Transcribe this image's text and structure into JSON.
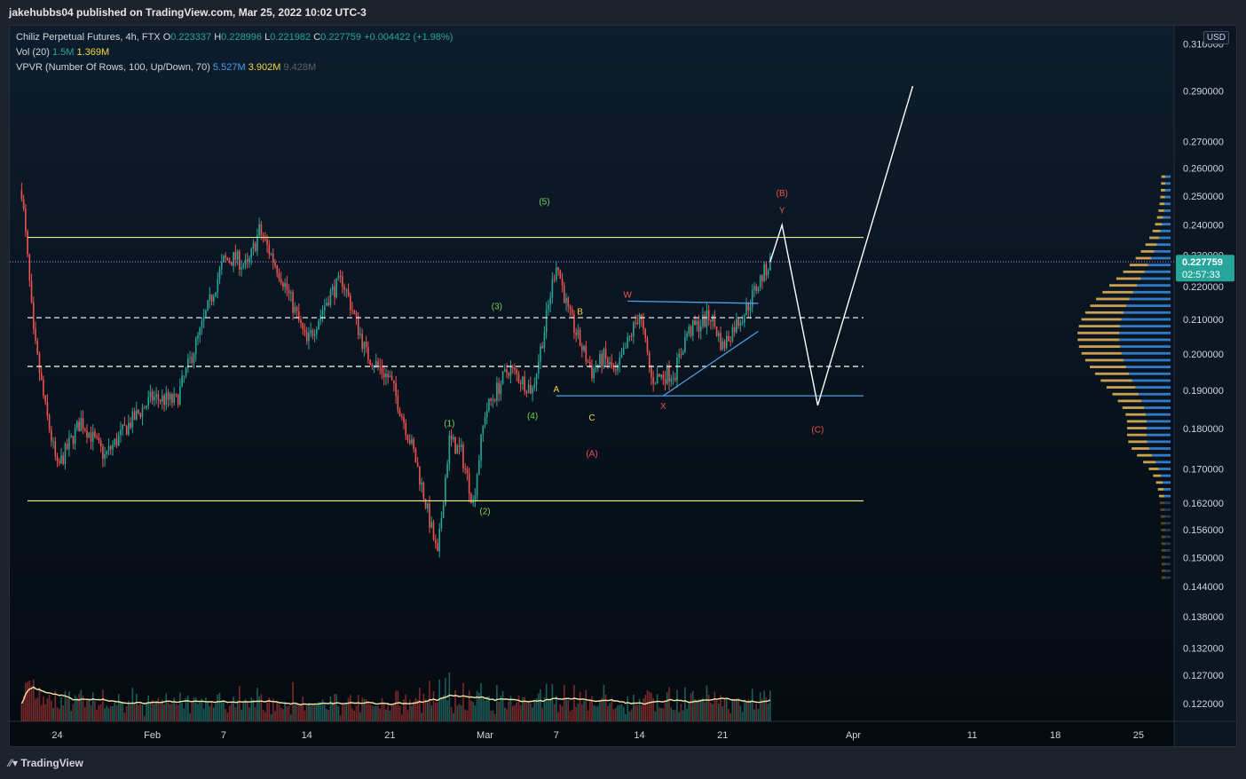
{
  "header": {
    "published_line": "jakehubbs04 published on TradingView.com, Mar 25, 2022 10:02 UTC-3"
  },
  "legend": {
    "symbol": "Chiliz Perpetual Futures, 4h, FTX",
    "o_label": "O",
    "o": "0.223337",
    "h_label": "H",
    "h": "0.228996",
    "l_label": "L",
    "l": "0.221982",
    "c_label": "C",
    "c": "0.227759",
    "change": "+0.004422 (+1.98%)",
    "vol_label": "Vol (20)",
    "vol1": "1.5M",
    "vol2": "1.369M",
    "vpvr_label": "VPVR (Number Of Rows, 100, Up/Down, 70)",
    "vpvr_up": "5.527M",
    "vpvr_down": "3.902M",
    "vpvr_total": "9.428M"
  },
  "currency": "USD",
  "price_axis": {
    "ticks": [
      "0.310000",
      "0.290000",
      "0.270000",
      "0.260000",
      "0.250000",
      "0.240000",
      "0.230000",
      "0.220000",
      "0.210000",
      "0.200000",
      "0.190000",
      "0.180000",
      "0.170000",
      "0.162000",
      "0.156000",
      "0.150000",
      "0.144000",
      "0.138000",
      "0.132000",
      "0.127000",
      "0.122000"
    ],
    "last_price": "0.227759",
    "countdown": "02:57:33"
  },
  "time_axis": {
    "labels": [
      "24",
      "Feb",
      "7",
      "14",
      "21",
      "Mar",
      "7",
      "14",
      "21",
      "Apr",
      "11",
      "18",
      "25"
    ]
  },
  "footer": {
    "brand": "TradingView"
  },
  "colors": {
    "up": "#26a69a",
    "down": "#ef5350",
    "accent_line": "#e6e68a",
    "current_price": "#c678dd",
    "badge": "#26a69a"
  },
  "chart_data": {
    "type": "candlestick",
    "symbol": "Chiliz Perpetual Futures",
    "interval": "4h",
    "exchange": "FTX",
    "x_range": [
      "2022-01-20",
      "2022-04-28"
    ],
    "ylim": [
      0.119,
      0.318
    ],
    "y_scale": "log",
    "close_series": [
      [
        "2022-01-21",
        0.252
      ],
      [
        "2022-01-22",
        0.205
      ],
      [
        "2022-01-23",
        0.185
      ],
      [
        "2022-01-24",
        0.17
      ],
      [
        "2022-01-25",
        0.176
      ],
      [
        "2022-01-26",
        0.182
      ],
      [
        "2022-01-28",
        0.173
      ],
      [
        "2022-01-30",
        0.181
      ],
      [
        "2022-02-01",
        0.188
      ],
      [
        "2022-02-03",
        0.187
      ],
      [
        "2022-02-05",
        0.206
      ],
      [
        "2022-02-07",
        0.228
      ],
      [
        "2022-02-08",
        0.229
      ],
      [
        "2022-02-09",
        0.226
      ],
      [
        "2022-02-10",
        0.238
      ],
      [
        "2022-02-12",
        0.222
      ],
      [
        "2022-02-14",
        0.203
      ],
      [
        "2022-02-16",
        0.218
      ],
      [
        "2022-02-17",
        0.222
      ],
      [
        "2022-02-19",
        0.2
      ],
      [
        "2022-02-21",
        0.193
      ],
      [
        "2022-02-23",
        0.174
      ],
      [
        "2022-02-24",
        0.162
      ],
      [
        "2022-02-25",
        0.15
      ],
      [
        "2022-02-26",
        0.177
      ],
      [
        "2022-02-27",
        0.174
      ],
      [
        "2022-02-28",
        0.162
      ],
      [
        "2022-03-01",
        0.184
      ],
      [
        "2022-03-03",
        0.196
      ],
      [
        "2022-03-05",
        0.19
      ],
      [
        "2022-03-06",
        0.207
      ],
      [
        "2022-03-07",
        0.228
      ],
      [
        "2022-03-08",
        0.212
      ],
      [
        "2022-03-09",
        0.203
      ],
      [
        "2022-03-10",
        0.195
      ],
      [
        "2022-03-11",
        0.199
      ],
      [
        "2022-03-12",
        0.194
      ],
      [
        "2022-03-14",
        0.212
      ],
      [
        "2022-03-15",
        0.193
      ],
      [
        "2022-03-17",
        0.195
      ],
      [
        "2022-03-18",
        0.206
      ],
      [
        "2022-03-20",
        0.211
      ],
      [
        "2022-03-21",
        0.202
      ],
      [
        "2022-03-22",
        0.208
      ],
      [
        "2022-03-23",
        0.213
      ],
      [
        "2022-03-24",
        0.221
      ],
      [
        "2022-03-25",
        0.2278
      ]
    ],
    "horizontal_levels": [
      {
        "price": 0.2358,
        "style": "solid",
        "color": "#e6e68a"
      },
      {
        "price": 0.2278,
        "style": "dotted",
        "color": "#c678dd"
      },
      {
        "price": 0.2105,
        "style": "dashed",
        "color": "#ffffff"
      },
      {
        "price": 0.1965,
        "style": "dashed",
        "color": "#ffffff"
      },
      {
        "price": 0.1885,
        "style": "solid",
        "color": "#4c9ee8"
      },
      {
        "price": 0.1625,
        "style": "solid",
        "color": "#e6e68a"
      }
    ],
    "projection_path": [
      [
        "2022-03-25",
        0.2278
      ],
      [
        "2022-03-26",
        0.24
      ],
      [
        "2022-03-29",
        0.186
      ],
      [
        "2022-04-06",
        0.292
      ]
    ],
    "wave_labels": [
      {
        "text": "(1)",
        "date": "2022-02-26",
        "price": 0.1805,
        "color": "#7bd35b"
      },
      {
        "text": "(2)",
        "date": "2022-03-01",
        "price": 0.1595,
        "color": "#7bd35b"
      },
      {
        "text": "(3)",
        "date": "2022-03-02",
        "price": 0.213,
        "color": "#7bd35b"
      },
      {
        "text": "(4)",
        "date": "2022-03-05",
        "price": 0.1825,
        "color": "#7bd35b"
      },
      {
        "text": "(5)",
        "date": "2022-03-06",
        "price": 0.247,
        "color": "#7bd35b"
      },
      {
        "text": "A",
        "date": "2022-03-07",
        "price": 0.1895,
        "color": "#f5d742"
      },
      {
        "text": "B",
        "date": "2022-03-09",
        "price": 0.2115,
        "color": "#f5d742"
      },
      {
        "text": "C",
        "date": "2022-03-10",
        "price": 0.182,
        "color": "#f5d742"
      },
      {
        "text": "(A)",
        "date": "2022-03-10",
        "price": 0.173,
        "color": "#ef5350"
      },
      {
        "text": "W",
        "date": "2022-03-13",
        "price": 0.2165,
        "color": "#ef5350"
      },
      {
        "text": "X",
        "date": "2022-03-16",
        "price": 0.185,
        "color": "#ef5350"
      },
      {
        "text": "(B)",
        "date": "2022-03-26",
        "price": 0.25,
        "color": "#ef5350"
      },
      {
        "text": "Y",
        "date": "2022-03-26",
        "price": 0.244,
        "color": "#ef5350"
      },
      {
        "text": "(C)",
        "date": "2022-03-29",
        "price": 0.179,
        "color": "#ef5350"
      }
    ],
    "volume_profile": {
      "position": "right",
      "up_color": "#2f7bc8",
      "down_color": "#c8a050"
    }
  }
}
